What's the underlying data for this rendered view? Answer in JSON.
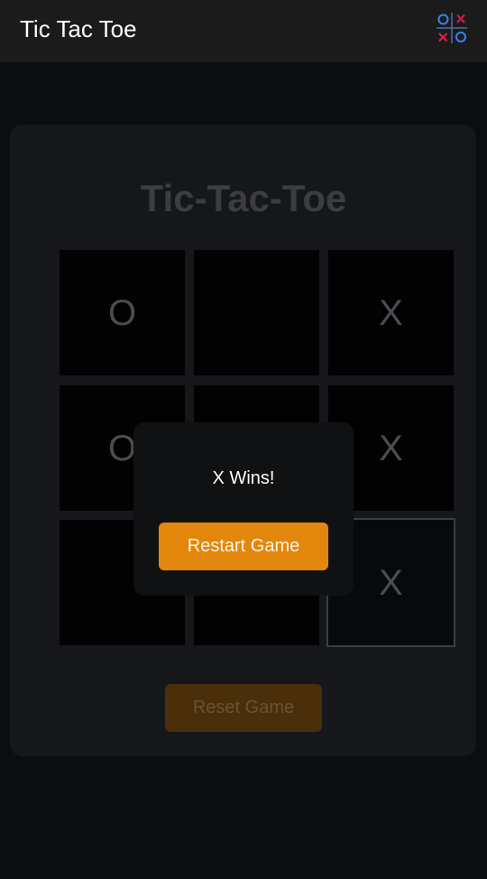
{
  "app_bar": {
    "title": "Tic Tac Toe",
    "icon": "tic-tac-toe-icon",
    "icon_colors": {
      "o": "#3b82f6",
      "x": "#e11d48"
    }
  },
  "game": {
    "title": "Tic-Tac-Toe",
    "board": [
      "O",
      "",
      "X",
      "O",
      "",
      "X",
      "",
      "",
      "X"
    ],
    "reset_label": "Reset Game"
  },
  "dialog": {
    "message": "X Wins!",
    "restart_label": "Restart Game"
  },
  "colors": {
    "accent": "#e3870c",
    "background": "#0b0d10",
    "card": "#15171b"
  }
}
